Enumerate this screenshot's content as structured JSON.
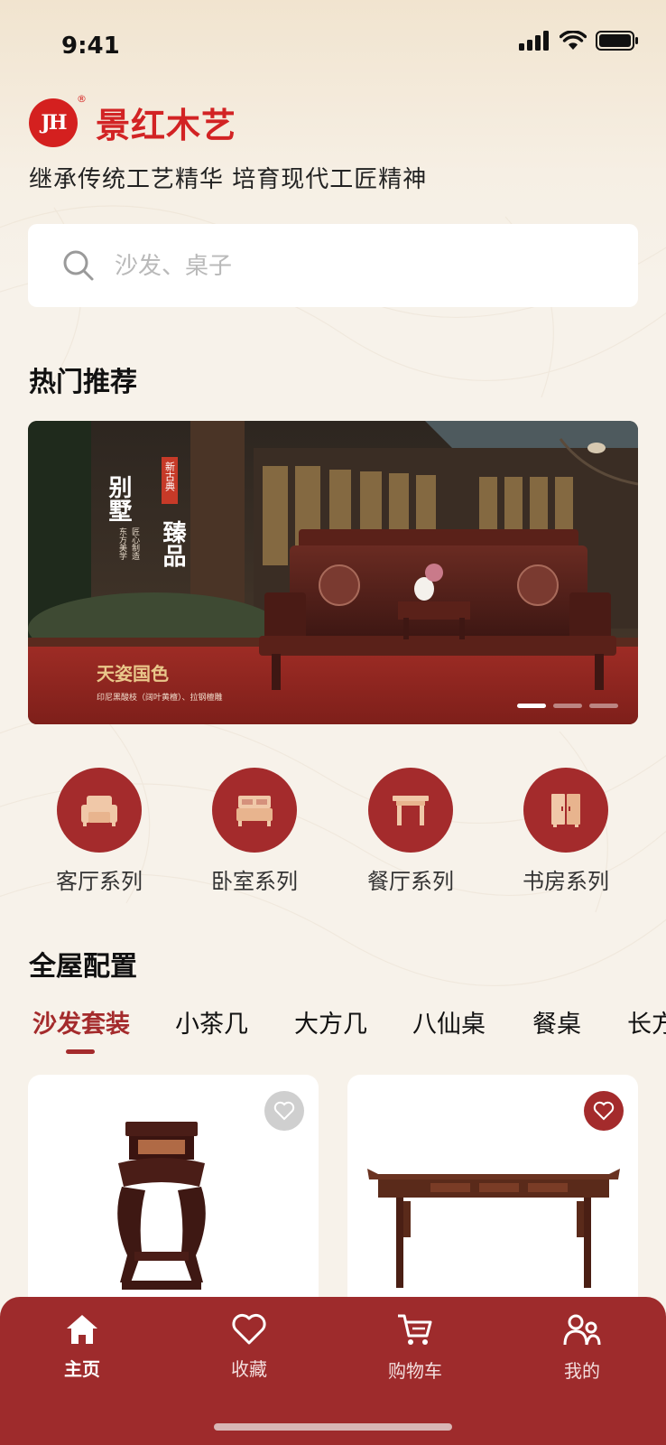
{
  "status_bar": {
    "time": "9:41"
  },
  "brand": {
    "logo_text": "JH",
    "name": "景红木艺",
    "slogan": "继承传统工艺精华  培育现代工匠精神"
  },
  "search": {
    "placeholder": "沙发、桌子"
  },
  "hot": {
    "title": "热门推荐",
    "banner": {
      "headline_a": "别墅",
      "headline_b": "臻品",
      "badge": "新古典",
      "vertical_small": "东方美学",
      "vertical_small_2": "匠心制造",
      "slogan": "天姿国色",
      "caption": "印尼黑酸枝（阔叶黄檀）、拉钢檀雕",
      "active_dot": 1,
      "dot_count": 3
    }
  },
  "categories": [
    {
      "label": "客厅系列",
      "icon": "sofa-icon"
    },
    {
      "label": "卧室系列",
      "icon": "bed-icon"
    },
    {
      "label": "餐厅系列",
      "icon": "table-icon"
    },
    {
      "label": "书房系列",
      "icon": "cabinet-icon"
    }
  ],
  "whole_house": {
    "title": "全屋配置",
    "tabs": [
      "沙发套装",
      "小茶几",
      "大方几",
      "八仙桌",
      "餐桌",
      "长方桌"
    ],
    "active_tab": 0
  },
  "products": [
    {
      "name": "flower-stand",
      "favorited": false
    },
    {
      "name": "altar-table",
      "favorited": true
    }
  ],
  "tabbar": [
    {
      "label": "主页",
      "icon": "home-icon",
      "active": true
    },
    {
      "label": "收藏",
      "icon": "heart-icon",
      "active": false
    },
    {
      "label": "购物车",
      "icon": "cart-icon",
      "active": false
    },
    {
      "label": "我的",
      "icon": "user-icon",
      "active": false
    }
  ],
  "colors": {
    "brand_red": "#d22324",
    "accent": "#a42b2c",
    "tabbar": "#9e2b2c"
  }
}
